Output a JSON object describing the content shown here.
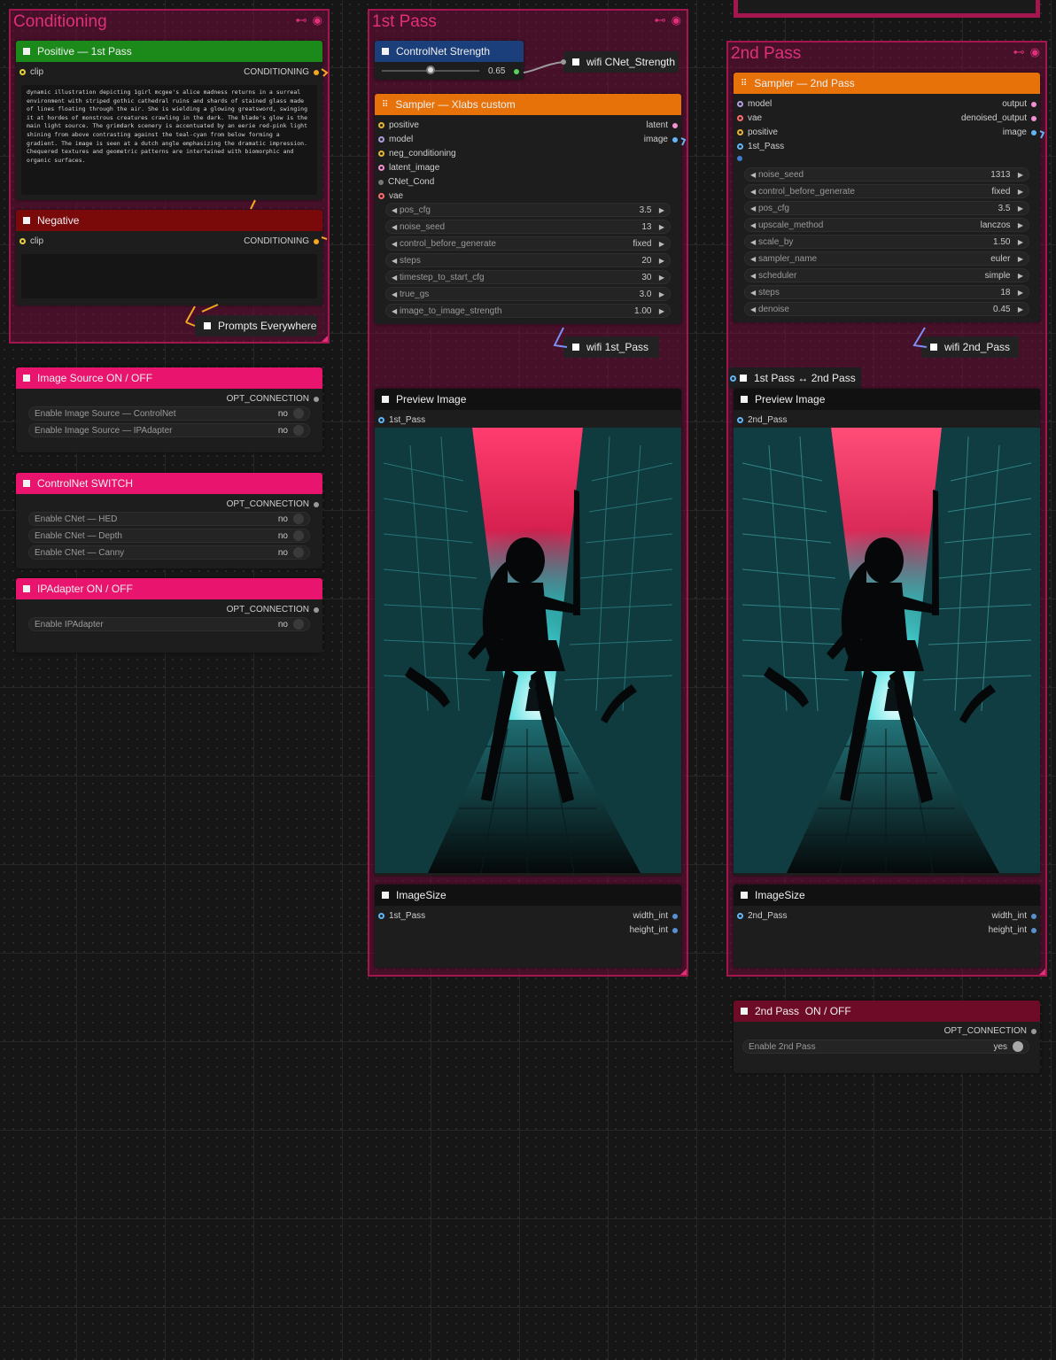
{
  "groups": {
    "conditioning": {
      "title": "Conditioning"
    },
    "first_pass": {
      "title": "1st Pass"
    },
    "second_pass": {
      "title": "2nd Pass"
    }
  },
  "positive_node": {
    "title": "Positive — 1st Pass",
    "input": "clip",
    "output": "CONDITIONING",
    "prompt": "dynamic illustration depicting 1girl mcgee's alice madness returns in a surreal environment with striped gothic cathedral ruins and shards of stained glass made of lines floating through the air. She is wielding a glowing greatsword, swinging it at hordes of monstrous creatures crawling in the dark. The blade's glow is the main light source. The grimdark scenery is accentuated by an eerie red-pink light shining from above contrasting against the teal-cyan from below forming a gradient. The image is seen at a dutch angle emphasizing the dramatic impression. Chequered textures and geometric patterns are intertwined with biomorphic and organic surfaces."
  },
  "negative_node": {
    "title": "Negative",
    "input": "clip",
    "output": "CONDITIONING"
  },
  "prompts_everywhere": {
    "title": "Prompts Everywhere"
  },
  "image_source_node": {
    "title": "Image Source ON / OFF",
    "output": "OPT_CONNECTION",
    "widgets": [
      {
        "label": "Enable Image Source — ControlNet",
        "value": "no"
      },
      {
        "label": "Enable Image Source — IPAdapter",
        "value": "no"
      }
    ]
  },
  "controlnet_switch_node": {
    "title": "ControlNet SWITCH",
    "output": "OPT_CONNECTION",
    "widgets": [
      {
        "label": "Enable CNet — HED",
        "value": "no"
      },
      {
        "label": "Enable CNet — Depth",
        "value": "no"
      },
      {
        "label": "Enable CNet — Canny",
        "value": "no"
      }
    ]
  },
  "ipadapter_node": {
    "title": "IPAdapter ON / OFF",
    "output": "OPT_CONNECTION",
    "widgets": [
      {
        "label": "Enable IPAdapter",
        "value": "no"
      }
    ]
  },
  "controlnet_strength_node": {
    "title": "ControlNet Strength",
    "value": "0.65",
    "slider_fraction": 0.5
  },
  "wifi_cnet": {
    "title": "wifi CNet_Strength"
  },
  "sampler1": {
    "title": "Sampler — Xlabs custom",
    "inputs": [
      "positive",
      "model",
      "neg_conditioning",
      "latent_image",
      "CNet_Cond",
      "vae"
    ],
    "outputs": [
      "latent",
      "image"
    ],
    "widgets": [
      {
        "label": "pos_cfg",
        "value": "3.5"
      },
      {
        "label": "noise_seed",
        "value": "13"
      },
      {
        "label": "control_before_generate",
        "value": "fixed"
      },
      {
        "label": "steps",
        "value": "20"
      },
      {
        "label": "timestep_to_start_cfg",
        "value": "30"
      },
      {
        "label": "true_gs",
        "value": "3.0"
      },
      {
        "label": "image_to_image_strength",
        "value": "1.00"
      }
    ]
  },
  "wifi_1st": {
    "title": "wifi 1st_Pass"
  },
  "preview1": {
    "title": "Preview Image",
    "input": "1st_Pass"
  },
  "imagesize1": {
    "title": "ImageSize",
    "input": "1st_Pass",
    "outputs": [
      "width_int",
      "height_int"
    ]
  },
  "sampler2": {
    "title": "Sampler — 2nd Pass",
    "inputs": [
      "model",
      "vae",
      "positive",
      "1st_Pass"
    ],
    "outputs": [
      "output",
      "denoised_output",
      "image"
    ],
    "widgets": [
      {
        "label": "noise_seed",
        "value": "1313"
      },
      {
        "label": "control_before_generate",
        "value": "fixed"
      },
      {
        "label": "pos_cfg",
        "value": "3.5"
      },
      {
        "label": "upscale_method",
        "value": "lanczos"
      },
      {
        "label": "scale_by",
        "value": "1.50"
      },
      {
        "label": "sampler_name",
        "value": "euler"
      },
      {
        "label": "scheduler",
        "value": "simple"
      },
      {
        "label": "steps",
        "value": "18"
      },
      {
        "label": "denoise",
        "value": "0.45"
      }
    ]
  },
  "wifi_2nd": {
    "title": "wifi 2nd_Pass"
  },
  "switch_pass": {
    "title": "1st Pass ↔ 2nd Pass"
  },
  "preview2": {
    "title": "Preview Image",
    "input": "2nd_Pass"
  },
  "imagesize2": {
    "title": "ImageSize",
    "input": "2nd_Pass",
    "outputs": [
      "width_int",
      "height_int"
    ]
  },
  "second_pass_toggle": {
    "title": "2nd Pass  ON / OFF",
    "output": "OPT_CONNECTION",
    "widgets": [
      {
        "label": "Enable 2nd Pass",
        "value": "yes"
      }
    ]
  },
  "colors": {
    "group_border": "#a3174e",
    "group_fill": "#700c3a",
    "positive_header": "#1b8a1b",
    "negative_header": "#7a0a0a",
    "pink_header": "#e8146e",
    "blue_header": "#1a3f7a",
    "orange_header": "#e8720a",
    "dark_red_header": "#6e0c28"
  },
  "icons": [
    "pin-icon",
    "eye-icon",
    "grid-icon",
    "node-square-icon",
    "toggle-icon",
    "left-arrow-icon",
    "right-arrow-icon"
  ]
}
